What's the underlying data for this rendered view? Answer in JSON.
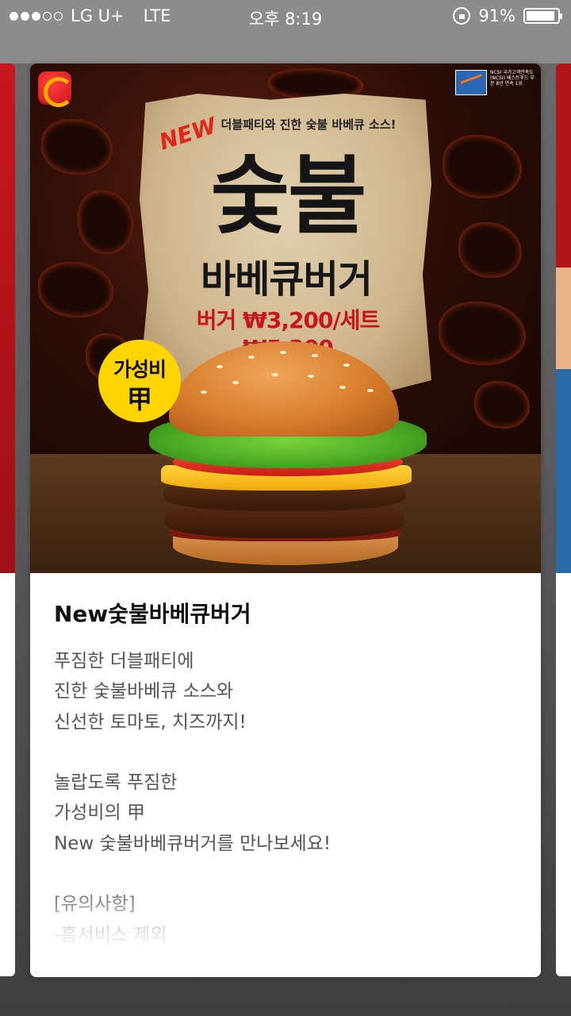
{
  "status_bar": {
    "carrier": "LG U+",
    "network": "LTE",
    "time": "오후 8:19",
    "battery": "91%",
    "battery_level": 0.91,
    "signal_bars": 3,
    "signal_max": 5
  },
  "hero": {
    "subtitle": "더블패티와 진한 숯불 바베큐 소스!",
    "new_tag": "NEW",
    "title_big": "숯불",
    "title_sub": "바베큐버거",
    "price": "버거 ₩3,200/세트 ₩5,200",
    "badge_line1": "가성비",
    "badge_line2": "甲",
    "ncsi_label": "NCSI",
    "ncsi_text": "국가고객만족도(NCSI) 패스트푸드 부문 8년 연속 1위"
  },
  "content": {
    "title": "New숯불바베큐버거",
    "paragraph1": [
      "푸짐한 더블패티에",
      "진한 숯불바베큐 소스와",
      "신선한 토마토, 치즈까지!"
    ],
    "paragraph2": [
      "놀랍도록 푸짐한",
      "가성비의 甲",
      "New 숯불바베큐버거를 만나보세요!"
    ],
    "notice_header": "[유의사항]",
    "notice_items": [
      "-홈서비스 제외"
    ]
  },
  "colors": {
    "brand_red": "#c8161d",
    "badge_yellow": "#ffd500",
    "card_bg": "#ffffff",
    "overlay": "#575757"
  }
}
